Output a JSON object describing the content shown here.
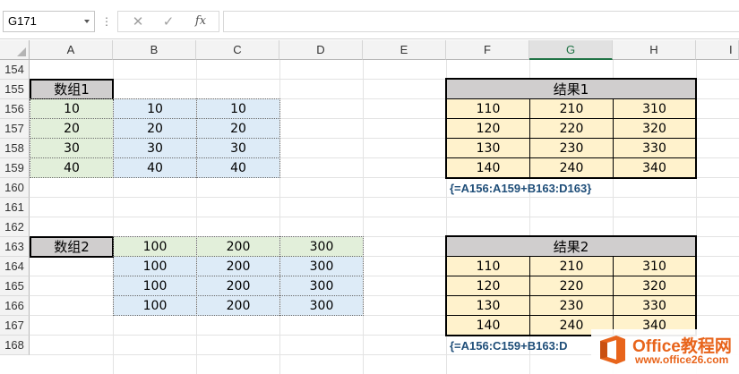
{
  "formula_bar": {
    "name_box": "G171",
    "separator_glyph": "⋮",
    "cancel_glyph": "✕",
    "enter_glyph": "✓",
    "fx_glyph": "fx",
    "formula": ""
  },
  "columns": [
    "A",
    "B",
    "C",
    "D",
    "E",
    "F",
    "G",
    "H",
    "I"
  ],
  "selected_column": "G",
  "rows": [
    "154",
    "155",
    "156",
    "157",
    "158",
    "159",
    "160",
    "161",
    "162",
    "163",
    "164",
    "165",
    "166",
    "167",
    "168"
  ],
  "sheet": {
    "array1_label": "数组1",
    "array2_label": "数组2",
    "array1": [
      [
        "10",
        "10",
        "10"
      ],
      [
        "20",
        "20",
        "20"
      ],
      [
        "30",
        "30",
        "30"
      ],
      [
        "40",
        "40",
        "40"
      ]
    ],
    "array2_row": [
      "100",
      "200",
      "300"
    ],
    "array2_rows_ext": [
      [
        "100",
        "200",
        "300"
      ],
      [
        "100",
        "200",
        "300"
      ],
      [
        "100",
        "200",
        "300"
      ]
    ],
    "result1_label": "结果1",
    "result1": [
      [
        "110",
        "210",
        "310"
      ],
      [
        "120",
        "220",
        "320"
      ],
      [
        "130",
        "230",
        "330"
      ],
      [
        "140",
        "240",
        "340"
      ]
    ],
    "result1_formula": "{=A156:A159+B163:D163}",
    "result2_label": "结果2",
    "result2": [
      [
        "110",
        "210",
        "310"
      ],
      [
        "120",
        "220",
        "320"
      ],
      [
        "130",
        "230",
        "330"
      ],
      [
        "140",
        "240",
        "340"
      ]
    ],
    "result2_formula": "{=A156:C159+B163:D"
  },
  "watermark": {
    "title": "Office教程网",
    "url": "www.office26.com"
  },
  "colors": {
    "green": "#e2efda",
    "blue": "#ddebf7",
    "yellow": "#fff2cc",
    "header_gray": "#d0cece",
    "formula_blue": "#1f4e79",
    "excel_green": "#217346",
    "watermark_orange": "#e8641b"
  }
}
